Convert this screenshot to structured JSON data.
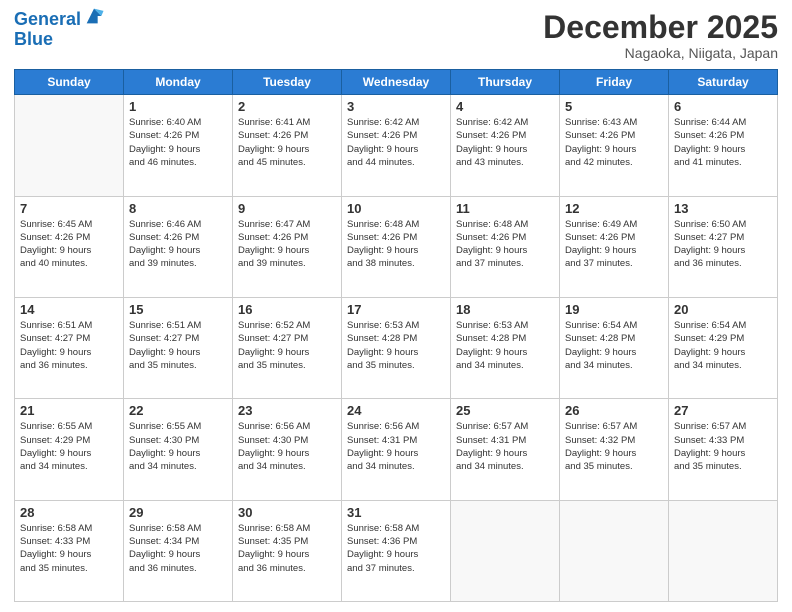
{
  "header": {
    "logo_line1": "General",
    "logo_line2": "Blue",
    "month": "December 2025",
    "location": "Nagaoka, Niigata, Japan"
  },
  "weekdays": [
    "Sunday",
    "Monday",
    "Tuesday",
    "Wednesday",
    "Thursday",
    "Friday",
    "Saturday"
  ],
  "weeks": [
    [
      {
        "day": "",
        "info": ""
      },
      {
        "day": "1",
        "info": "Sunrise: 6:40 AM\nSunset: 4:26 PM\nDaylight: 9 hours\nand 46 minutes."
      },
      {
        "day": "2",
        "info": "Sunrise: 6:41 AM\nSunset: 4:26 PM\nDaylight: 9 hours\nand 45 minutes."
      },
      {
        "day": "3",
        "info": "Sunrise: 6:42 AM\nSunset: 4:26 PM\nDaylight: 9 hours\nand 44 minutes."
      },
      {
        "day": "4",
        "info": "Sunrise: 6:42 AM\nSunset: 4:26 PM\nDaylight: 9 hours\nand 43 minutes."
      },
      {
        "day": "5",
        "info": "Sunrise: 6:43 AM\nSunset: 4:26 PM\nDaylight: 9 hours\nand 42 minutes."
      },
      {
        "day": "6",
        "info": "Sunrise: 6:44 AM\nSunset: 4:26 PM\nDaylight: 9 hours\nand 41 minutes."
      }
    ],
    [
      {
        "day": "7",
        "info": "Sunrise: 6:45 AM\nSunset: 4:26 PM\nDaylight: 9 hours\nand 40 minutes."
      },
      {
        "day": "8",
        "info": "Sunrise: 6:46 AM\nSunset: 4:26 PM\nDaylight: 9 hours\nand 39 minutes."
      },
      {
        "day": "9",
        "info": "Sunrise: 6:47 AM\nSunset: 4:26 PM\nDaylight: 9 hours\nand 39 minutes."
      },
      {
        "day": "10",
        "info": "Sunrise: 6:48 AM\nSunset: 4:26 PM\nDaylight: 9 hours\nand 38 minutes."
      },
      {
        "day": "11",
        "info": "Sunrise: 6:48 AM\nSunset: 4:26 PM\nDaylight: 9 hours\nand 37 minutes."
      },
      {
        "day": "12",
        "info": "Sunrise: 6:49 AM\nSunset: 4:26 PM\nDaylight: 9 hours\nand 37 minutes."
      },
      {
        "day": "13",
        "info": "Sunrise: 6:50 AM\nSunset: 4:27 PM\nDaylight: 9 hours\nand 36 minutes."
      }
    ],
    [
      {
        "day": "14",
        "info": "Sunrise: 6:51 AM\nSunset: 4:27 PM\nDaylight: 9 hours\nand 36 minutes."
      },
      {
        "day": "15",
        "info": "Sunrise: 6:51 AM\nSunset: 4:27 PM\nDaylight: 9 hours\nand 35 minutes."
      },
      {
        "day": "16",
        "info": "Sunrise: 6:52 AM\nSunset: 4:27 PM\nDaylight: 9 hours\nand 35 minutes."
      },
      {
        "day": "17",
        "info": "Sunrise: 6:53 AM\nSunset: 4:28 PM\nDaylight: 9 hours\nand 35 minutes."
      },
      {
        "day": "18",
        "info": "Sunrise: 6:53 AM\nSunset: 4:28 PM\nDaylight: 9 hours\nand 34 minutes."
      },
      {
        "day": "19",
        "info": "Sunrise: 6:54 AM\nSunset: 4:28 PM\nDaylight: 9 hours\nand 34 minutes."
      },
      {
        "day": "20",
        "info": "Sunrise: 6:54 AM\nSunset: 4:29 PM\nDaylight: 9 hours\nand 34 minutes."
      }
    ],
    [
      {
        "day": "21",
        "info": "Sunrise: 6:55 AM\nSunset: 4:29 PM\nDaylight: 9 hours\nand 34 minutes."
      },
      {
        "day": "22",
        "info": "Sunrise: 6:55 AM\nSunset: 4:30 PM\nDaylight: 9 hours\nand 34 minutes."
      },
      {
        "day": "23",
        "info": "Sunrise: 6:56 AM\nSunset: 4:30 PM\nDaylight: 9 hours\nand 34 minutes."
      },
      {
        "day": "24",
        "info": "Sunrise: 6:56 AM\nSunset: 4:31 PM\nDaylight: 9 hours\nand 34 minutes."
      },
      {
        "day": "25",
        "info": "Sunrise: 6:57 AM\nSunset: 4:31 PM\nDaylight: 9 hours\nand 34 minutes."
      },
      {
        "day": "26",
        "info": "Sunrise: 6:57 AM\nSunset: 4:32 PM\nDaylight: 9 hours\nand 35 minutes."
      },
      {
        "day": "27",
        "info": "Sunrise: 6:57 AM\nSunset: 4:33 PM\nDaylight: 9 hours\nand 35 minutes."
      }
    ],
    [
      {
        "day": "28",
        "info": "Sunrise: 6:58 AM\nSunset: 4:33 PM\nDaylight: 9 hours\nand 35 minutes."
      },
      {
        "day": "29",
        "info": "Sunrise: 6:58 AM\nSunset: 4:34 PM\nDaylight: 9 hours\nand 36 minutes."
      },
      {
        "day": "30",
        "info": "Sunrise: 6:58 AM\nSunset: 4:35 PM\nDaylight: 9 hours\nand 36 minutes."
      },
      {
        "day": "31",
        "info": "Sunrise: 6:58 AM\nSunset: 4:36 PM\nDaylight: 9 hours\nand 37 minutes."
      },
      {
        "day": "",
        "info": ""
      },
      {
        "day": "",
        "info": ""
      },
      {
        "day": "",
        "info": ""
      }
    ]
  ]
}
